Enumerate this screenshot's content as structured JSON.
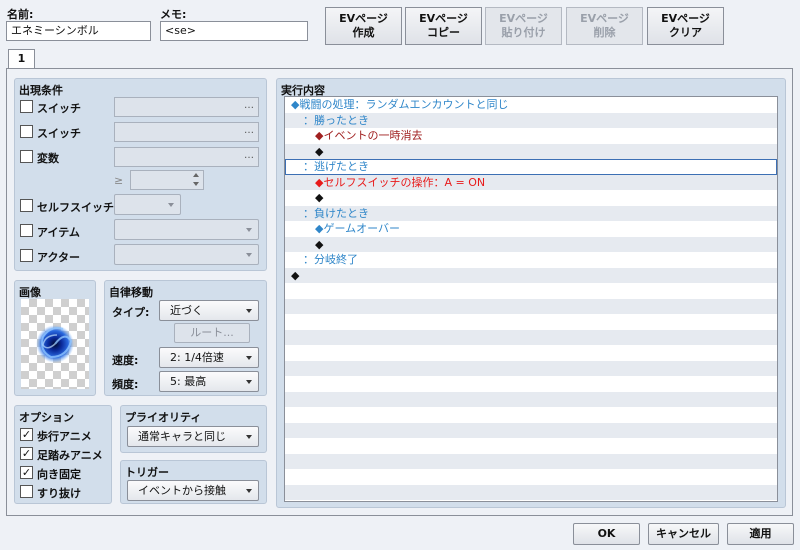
{
  "window": {
    "name_label": "名前:",
    "name_value": "エネミーシンボル",
    "memo_label": "メモ:",
    "memo_value": "<se>"
  },
  "top_buttons": [
    {
      "line1": "EVページ",
      "line2": "作成",
      "enabled": true
    },
    {
      "line1": "EVページ",
      "line2": "コピー",
      "enabled": true
    },
    {
      "line1": "EVページ",
      "line2": "貼り付け",
      "enabled": false
    },
    {
      "line1": "EVページ",
      "line2": "削除",
      "enabled": false
    },
    {
      "line1": "EVページ",
      "line2": "クリア",
      "enabled": true
    }
  ],
  "tab": {
    "label": "1"
  },
  "conditions": {
    "title": "出現条件",
    "switch1": "スイッチ",
    "switch2": "スイッチ",
    "variable": "変数",
    "ellipsis": "…",
    "ge": "≥",
    "self_switch": "セルフスイッチ",
    "item": "アイテム",
    "actor": "アクター"
  },
  "image": {
    "title": "画像"
  },
  "autonomous": {
    "title": "自律移動",
    "type_label": "タイプ:",
    "type_value": "近づく",
    "route_button": "ルート...",
    "speed_label": "速度:",
    "speed_value": "2: 1/4倍速",
    "freq_label": "頻度:",
    "freq_value": "5: 最高"
  },
  "options": {
    "title": "オプション",
    "items": [
      {
        "label": "歩行アニメ",
        "checked": true
      },
      {
        "label": "足踏みアニメ",
        "checked": true
      },
      {
        "label": "向き固定",
        "checked": true
      },
      {
        "label": "すり抜け",
        "checked": false
      }
    ],
    "check_mark": "✓"
  },
  "priority": {
    "title": "プライオリティ",
    "value": "通常キャラと同じ"
  },
  "trigger": {
    "title": "トリガー",
    "value": "イベントから接触"
  },
  "contents": {
    "title": "実行内容",
    "rows": [
      {
        "text": "◆戦闘の処理：ランダムエンカウントと同じ",
        "indent": 0,
        "color": "blue"
      },
      {
        "text": "：勝ったとき",
        "indent": 1,
        "color": "blue"
      },
      {
        "text": "◆イベントの一時消去",
        "indent": 2,
        "color": "dred"
      },
      {
        "text": "◆",
        "indent": 2,
        "color": "black"
      },
      {
        "text": "：逃げたとき",
        "indent": 1,
        "color": "blue",
        "selected": true
      },
      {
        "text": "◆セルフスイッチの操作：A = ON",
        "indent": 2,
        "color": "red"
      },
      {
        "text": "◆",
        "indent": 2,
        "color": "black"
      },
      {
        "text": "：負けたとき",
        "indent": 1,
        "color": "blue"
      },
      {
        "text": "◆ゲームオーバー",
        "indent": 2,
        "color": "blue"
      },
      {
        "text": "◆",
        "indent": 2,
        "color": "black"
      },
      {
        "text": "：分岐終了",
        "indent": 1,
        "color": "blue"
      },
      {
        "text": "◆",
        "indent": 0,
        "color": "black"
      }
    ]
  },
  "footer": {
    "ok": "OK",
    "cancel": "キャンセル",
    "apply": "適用"
  }
}
